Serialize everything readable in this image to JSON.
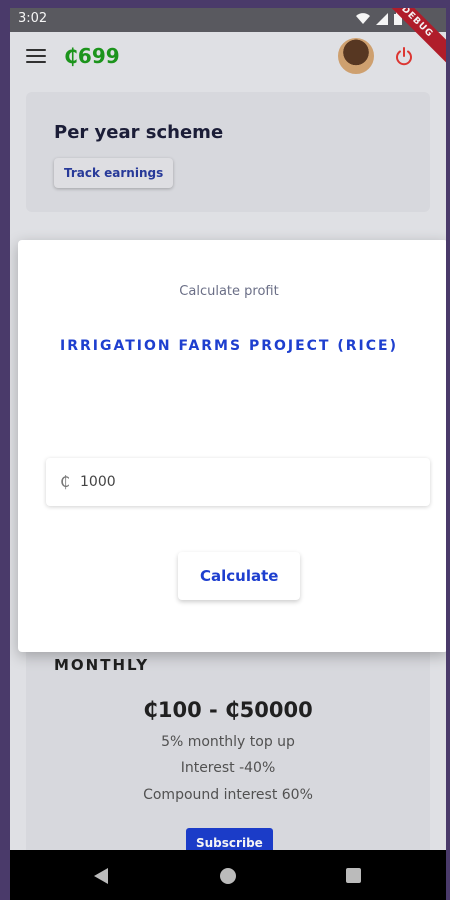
{
  "status_bar": {
    "time": "3:02"
  },
  "app_bar": {
    "balance": "₵699",
    "debug_ribbon": "DEBUG"
  },
  "scheme_card": {
    "title": "Per year scheme",
    "track_label": "Track earnings"
  },
  "dialog": {
    "caption": "Calculate profit",
    "project": "IRRIGATION FARMS PROJECT (RICE)",
    "currency_prefix": "₵",
    "amount_value": "1000",
    "calculate_label": "Calculate"
  },
  "monthly_card": {
    "frequency": "MONTHLY",
    "range": "₵100 - ₵50000",
    "line1": "5% monthly top up",
    "line2": "Interest -40%",
    "line3": "Compound interest 60%",
    "subscribe_label": "Subscribe"
  },
  "colors": {
    "accent": "#1e3fcf",
    "balance": "#1e9b1e",
    "power": "#e53935"
  },
  "icons": [
    "menu-icon",
    "power-icon",
    "wifi-icon",
    "signal-icon",
    "battery-icon",
    "back-icon",
    "home-icon",
    "recent-apps-icon"
  ]
}
